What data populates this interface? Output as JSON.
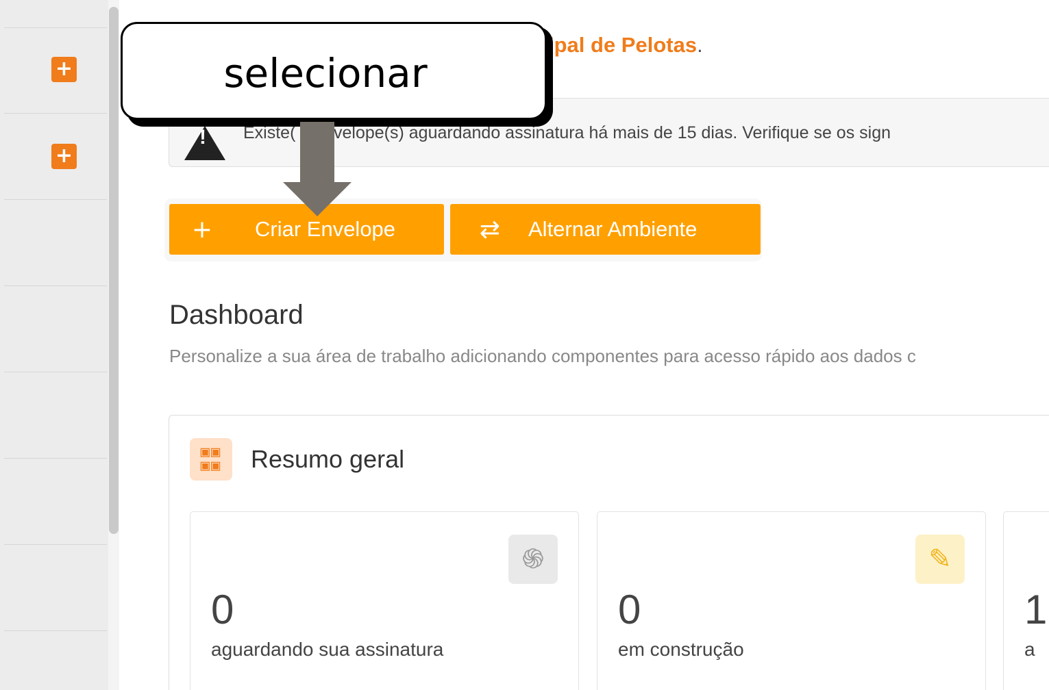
{
  "sidebar": {
    "add_icon_1": "+",
    "add_icon_2": "+"
  },
  "header": {
    "org_name": "ipal de Pelotas",
    "org_suffix": "."
  },
  "alert": {
    "icon_mark": "!",
    "message": "Existe(    1 envelope(s) aguardando assinatura há mais de 15 dias. Verifique se os sign"
  },
  "toolbar": {
    "create_icon": "+",
    "create_label": "Criar Envelope",
    "switch_icon": "⇄",
    "switch_label": "Alternar Ambiente"
  },
  "dashboard": {
    "title": "Dashboard",
    "subtitle": "Personalize a sua área de trabalho adicionando componentes para acesso rápido aos dados c"
  },
  "summary": {
    "title": "Resumo geral",
    "icon": "qr-grid-icon",
    "cards": [
      {
        "value": "0",
        "label": "aguardando sua assinatura",
        "icon": "fingerprint-icon",
        "icon_bg": "#e9e9e9",
        "icon_color": "#9a9a9a",
        "glyph": "֍"
      },
      {
        "value": "0",
        "label": "em construção",
        "icon": "pencil-icon",
        "icon_bg": "#fdf1c8",
        "icon_color": "#f2b41c",
        "glyph": "✎"
      },
      {
        "value": "1",
        "label": "a"
      }
    ]
  },
  "annotation": {
    "text": "selecionar"
  },
  "colors": {
    "accent": "#ffa000",
    "brand_orange": "#f07c1b"
  }
}
